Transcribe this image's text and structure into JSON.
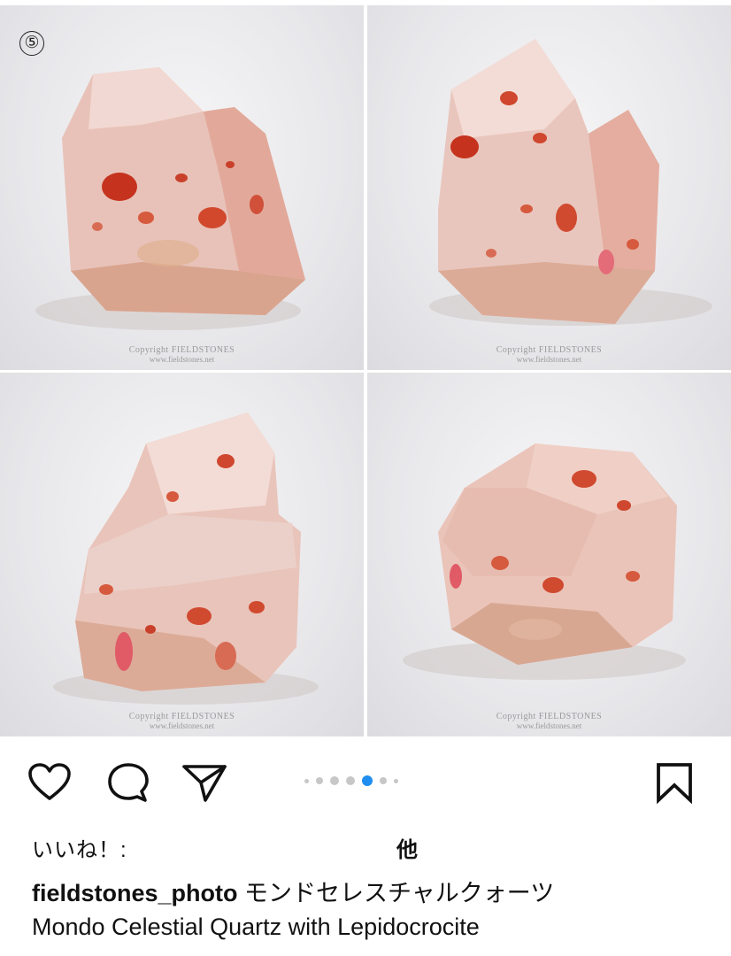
{
  "post": {
    "image_index_badge": "⑤",
    "photos": [
      {
        "name": "crystal-view-1",
        "copyright_line1": "Copyright FIELDSTONES",
        "copyright_line2": "www.fieldstones.net"
      },
      {
        "name": "crystal-view-2",
        "copyright_line1": "Copyright FIELDSTONES",
        "copyright_line2": "www.fieldstones.net"
      },
      {
        "name": "crystal-view-3",
        "copyright_line1": "Copyright FIELDSTONES",
        "copyright_line2": "www.fieldstones.net"
      },
      {
        "name": "crystal-view-4",
        "copyright_line1": "Copyright FIELDSTONES",
        "copyright_line2": "www.fieldstones.net"
      }
    ]
  },
  "actions": {
    "icons": [
      "heart-icon",
      "comment-icon",
      "share-icon",
      "bookmark-icon"
    ],
    "carousel": {
      "total_dots": 7,
      "active_index": 4,
      "active_color": "#1f8ef1"
    }
  },
  "likes": {
    "label": "いいね！:",
    "others": "他"
  },
  "caption": {
    "username": "fieldstones_photo",
    "title_jp": "モンドセレスチャルクォーツ",
    "title_en": "Mondo Celestial Quartz with Lepidocrocite"
  }
}
